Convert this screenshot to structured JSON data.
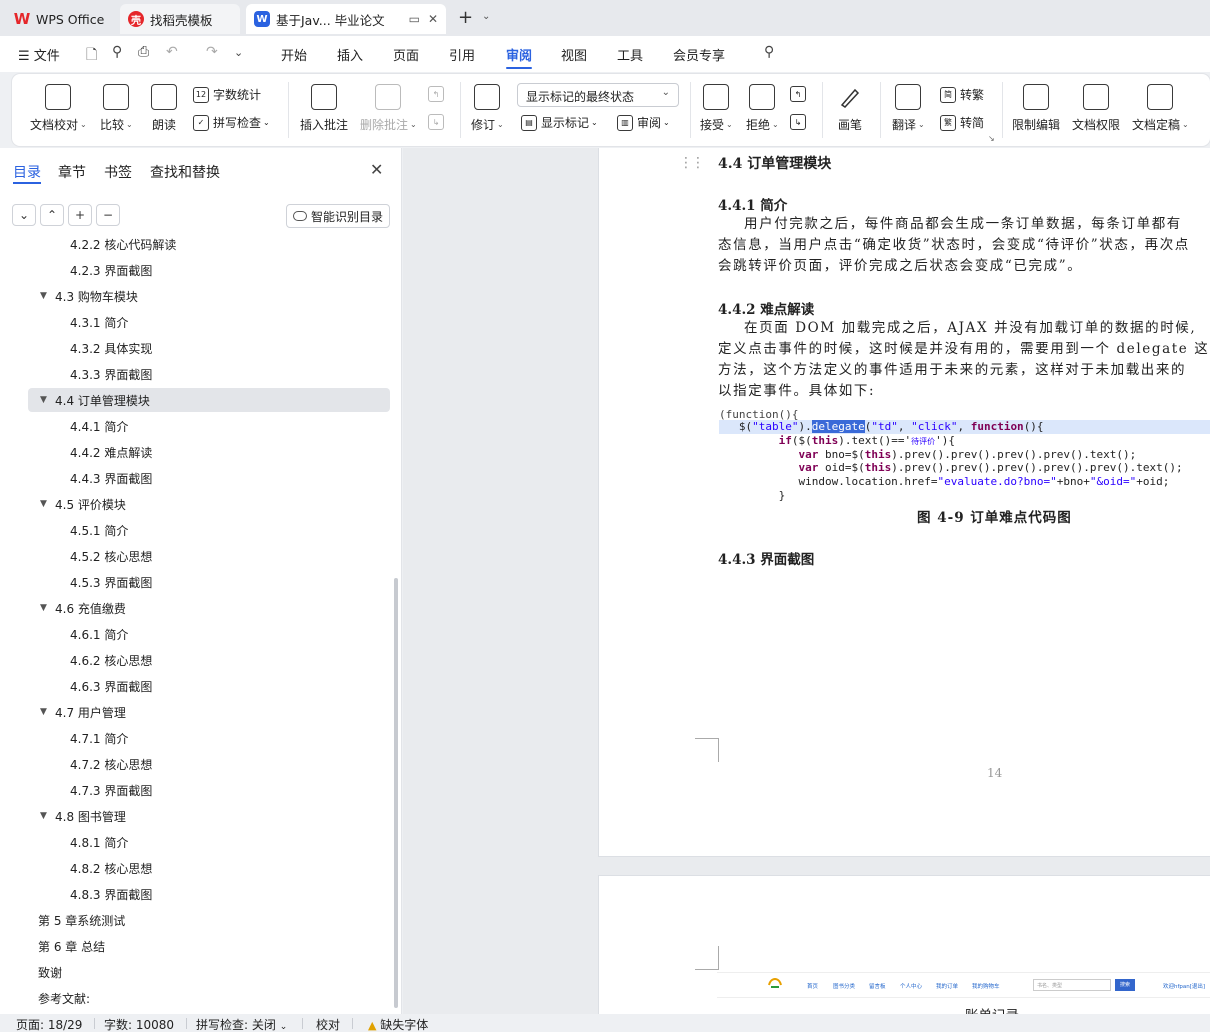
{
  "tabs": {
    "wps": "WPS Office",
    "daoke": "找稻壳模板",
    "doc": "基于Jav... 毕业论文"
  },
  "menubar": {
    "file": "文件",
    "items": [
      "开始",
      "插入",
      "页面",
      "引用",
      "审阅",
      "视图",
      "工具",
      "会员专享"
    ],
    "active": "审阅"
  },
  "ribbon": {
    "doc_check": "文档校对",
    "compare": "比较",
    "read_aloud": "朗读",
    "word_count": "字数统计",
    "spell_check": "拼写检查",
    "insert_comment": "插入批注",
    "delete_comment": "删除批注",
    "revise": "修订",
    "markup_state": "显示标记的最终状态",
    "show_markup": "显示标记",
    "review": "审阅",
    "accept": "接受",
    "reject": "拒绝",
    "pen": "画笔",
    "translate": "翻译",
    "to_traditional": "转繁",
    "to_simplified": "转简",
    "restrict_edit": "限制编辑",
    "doc_permission": "文档权限",
    "doc_finalize": "文档定稿"
  },
  "nav": {
    "tabs": [
      "目录",
      "章节",
      "书签",
      "查找和替换"
    ],
    "smart_toc": "智能识别目录",
    "toc": [
      {
        "label": "4.2.2  核心代码解读",
        "level": 3
      },
      {
        "label": "4.2.3 界面截图",
        "level": 3
      },
      {
        "label": "4.3  购物车模块",
        "level": 2
      },
      {
        "label": "4.3.1  简介",
        "level": 3
      },
      {
        "label": "4.3.2  具体实现",
        "level": 3
      },
      {
        "label": "4.3.3 界面截图",
        "level": 3
      },
      {
        "label": "4.4 订单管理模块",
        "level": 2,
        "selected": true
      },
      {
        "label": "4.4.1 简介",
        "level": 3
      },
      {
        "label": "4.4.2 难点解读",
        "level": 3
      },
      {
        "label": "4.4.3 界面截图",
        "level": 3
      },
      {
        "label": "4.5 评价模块",
        "level": 2
      },
      {
        "label": "4.5.1 简介",
        "level": 3
      },
      {
        "label": "4.5.2 核心思想",
        "level": 3
      },
      {
        "label": "4.5.3 界面截图",
        "level": 3
      },
      {
        "label": "4.6 充值缴费",
        "level": 2
      },
      {
        "label": "4.6.1 简介",
        "level": 3
      },
      {
        "label": "4.6.2 核心思想",
        "level": 3
      },
      {
        "label": "4.6.3 界面截图",
        "level": 3
      },
      {
        "label": "4.7 用户管理",
        "level": 2
      },
      {
        "label": "4.7.1 简介",
        "level": 3
      },
      {
        "label": "4.7.2 核心思想",
        "level": 3
      },
      {
        "label": "4.7.3 界面截图",
        "level": 3
      },
      {
        "label": "4.8 图书管理",
        "level": 2
      },
      {
        "label": "4.8.1 简介",
        "level": 3
      },
      {
        "label": "4.8.2  核心思想",
        "level": 3
      },
      {
        "label": "4.8.3 界面截图",
        "level": 3
      },
      {
        "label": "第 5 章系统测试",
        "level": 1
      },
      {
        "label": "第 6 章  总结",
        "level": 1
      },
      {
        "label": "致谢",
        "level": 1
      },
      {
        "label": "参考文献:",
        "level": 1
      }
    ]
  },
  "doc": {
    "h_44": "4.4 订单管理模块",
    "h_441": "4.4.1 简介",
    "p1": [
      "用户付完款之后，每件商品都会生成一条订单数据，每条订单都有",
      "态信息，当用户点击“确定收货”状态时，会变成“待评价”状态，再次点",
      "会跳转评价页面，评价完成之后状态会变成“已完成”。"
    ],
    "h_442": "4.4.2 难点解读",
    "p2": [
      "在页面 DOM 加载完成之后，AJAX 并没有加载订单的数据的时候,",
      "定义点击事件的时候，这时候是并没有用的，需要用到一个 delegate 这",
      "方法，这个方法定义的事件适用于未来的元素，这样对于未加载出来的",
      "以指定事件。具体如下:"
    ],
    "code_first": "(function(){",
    "code_tiny": "待评价",
    "fig_caption": "图 4-9 订单难点代码图",
    "h_443": "4.4.3 界面截图",
    "page_number": "14",
    "page2_cut": "账单记录"
  },
  "mini_site": {
    "logo": "bookstore",
    "nav": [
      "首页",
      "图书分类",
      "留言板",
      "个人中心",
      "我的订单",
      "我的购物车"
    ],
    "search_placeholder": "书名、类型",
    "search_btn": "搜索",
    "welcome": "欢迎hfpan[退出]"
  },
  "status": {
    "page": "页面: 18/29",
    "words": "字数: 10080",
    "spell": "拼写检查: 关闭",
    "proof": "校对",
    "missing_font": "缺失字体"
  }
}
